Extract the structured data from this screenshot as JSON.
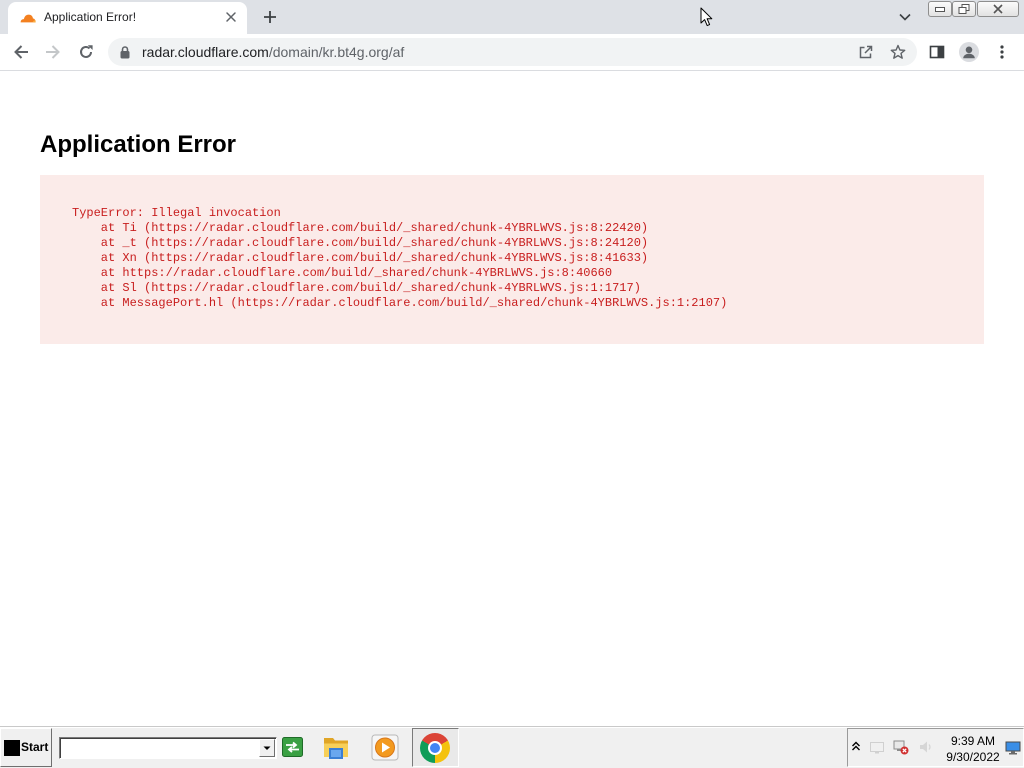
{
  "browser": {
    "tab": {
      "title": "Application Error!",
      "favicon": "cloudflare-favicon-icon",
      "close_icon": "close-icon"
    },
    "tab_strip_icons": [
      "plus-icon",
      "chevron-down-icon"
    ],
    "window_control_icons": [
      "minimize-icon",
      "restore-icon",
      "close-icon"
    ],
    "nav_icons": [
      "back-arrow-icon",
      "forward-arrow-icon",
      "reload-icon"
    ],
    "omnibox": {
      "security_icon": "lock-icon",
      "url_host": "radar.cloudflare.com",
      "url_path": "/domain/kr.bt4g.org/af",
      "action_icons": [
        "share-icon",
        "star-icon"
      ]
    },
    "toolbar_icons": [
      "side-panel-icon",
      "profile-avatar-icon",
      "more-menu-icon"
    ],
    "overlay_icons": [
      "mouse-cursor-icon"
    ]
  },
  "page": {
    "heading": "Application Error",
    "error_lines": [
      "TypeError: Illegal invocation",
      "    at Ti (https://radar.cloudflare.com/build/_shared/chunk-4YBRLWVS.js:8:22420)",
      "    at _t (https://radar.cloudflare.com/build/_shared/chunk-4YBRLWVS.js:8:24120)",
      "    at Xn (https://radar.cloudflare.com/build/_shared/chunk-4YBRLWVS.js:8:41633)",
      "    at https://radar.cloudflare.com/build/_shared/chunk-4YBRLWVS.js:8:40660",
      "    at Sl (https://radar.cloudflare.com/build/_shared/chunk-4YBRLWVS.js:1:1717)",
      "    at MessagePort.hl (https://radar.cloudflare.com/build/_shared/chunk-4YBRLWVS.js:1:2107)"
    ]
  },
  "taskbar": {
    "start_label": "Start",
    "start_icon": "start-logo-icon",
    "toolbar_icons": [
      "dropdown-arrow-icon",
      "go-icon"
    ],
    "pinned_icons": [
      "folder-icon",
      "media-player-icon",
      "chrome-icon"
    ],
    "tray_icons": [
      "show-hidden-icons-icon",
      "tray-app-icon",
      "network-error-icon",
      "volume-icon",
      "show-desktop-icon"
    ],
    "clock": {
      "time": "9:39 AM",
      "date": "9/30/2022"
    }
  },
  "colors": {
    "tab_strip_bg": "#dee1e6",
    "omnibox_bg": "#f1f3f4",
    "url_host": "#202124",
    "url_path": "#5f6368",
    "error_bg": "#fbebe9",
    "error_text": "#c81e1e",
    "taskbar_bg": "#f0f0f0"
  }
}
